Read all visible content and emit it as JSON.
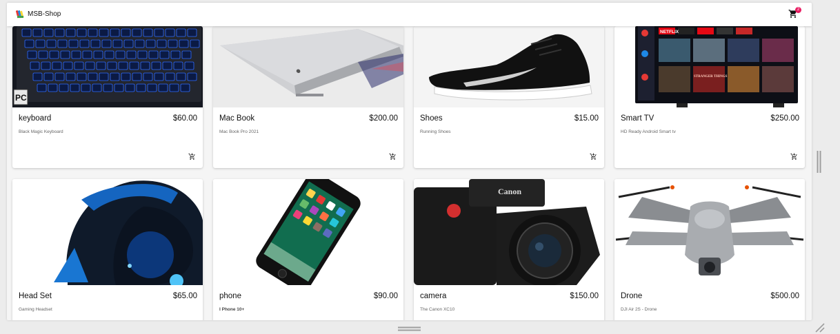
{
  "app": {
    "title": "MSB-Shop",
    "cart_count": "2"
  },
  "products": [
    {
      "name": "keyboard",
      "price": "$60.00",
      "description": "Black Magic Keyboard",
      "image": "keyboard-image"
    },
    {
      "name": "Mac Book",
      "price": "$200.00",
      "description": "Mac Book Pro 2021",
      "image": "laptop-image"
    },
    {
      "name": "Shoes",
      "price": "$15.00",
      "description": "Running Shoes",
      "image": "shoes-image"
    },
    {
      "name": "Smart TV",
      "price": "$250.00",
      "description": "HD Ready Android Smart tv",
      "image": "tv-image"
    },
    {
      "name": "Head Set",
      "price": "$65.00",
      "description": "Gaming Headset",
      "image": "headset-image"
    },
    {
      "name": "phone",
      "price": "$90.00",
      "description": "I Phone 10+",
      "image": "phone-image"
    },
    {
      "name": "camera",
      "price": "$150.00",
      "description": "The Canon XC10",
      "image": "camera-image"
    },
    {
      "name": "Drone",
      "price": "$500.00",
      "description": "DJI Air 2S - Drone",
      "image": "drone-image"
    }
  ],
  "image_text": {
    "keyboard_badge": "PC",
    "tv_brand": "NETFLIX",
    "tv_show": "STRANGER THINGS",
    "camera_brand": "Canon"
  },
  "colors": {
    "badge": "#e91e63",
    "appbar": "#ffffff",
    "background": "#f5f5f5"
  }
}
